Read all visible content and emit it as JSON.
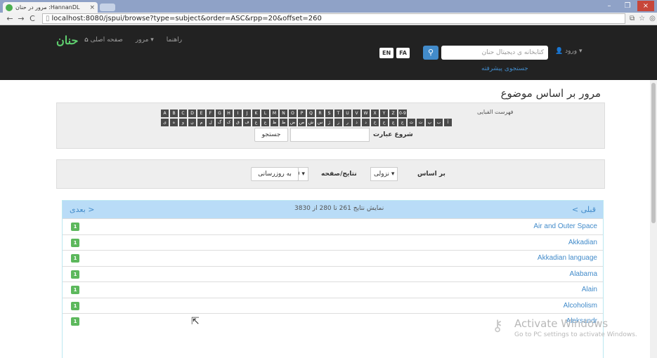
{
  "browser": {
    "tab_title": "مرور در حنان :HannanDL",
    "tab_close": "×",
    "url": "localhost:8080/jspui/browse?type=subject&order=ASC&rpp=20&offset=260",
    "back": "←",
    "forward": "→",
    "reload": "C",
    "win_min": "–",
    "win_max": "❐",
    "win_close": "×"
  },
  "navbar": {
    "logo": "حنان",
    "home": "صفحه اصلی",
    "browse": "مرور ▾",
    "help": "راهنما",
    "lang_en": "EN",
    "lang_fa": "FA",
    "search_placeholder": "کتابخانه ی دیجیتال حنان",
    "login": "ورود ▾",
    "advanced_search": "جستجوی پیشرفته"
  },
  "page_title": "مرور بر اساس موضوع",
  "jump": {
    "list_label": "فهرست الفبایی",
    "latin_letters": [
      "0-9",
      "Z",
      "Y",
      "X",
      "W",
      "V",
      "U",
      "T",
      "S",
      "R",
      "Q",
      "P",
      "O",
      "N",
      "M",
      "L",
      "K",
      "J",
      "I",
      "H",
      "G",
      "F",
      "E",
      "D",
      "C",
      "B",
      "A"
    ],
    "persian_letters": [
      "آ",
      "ب",
      "پ",
      "ت",
      "ث",
      "ج",
      "چ",
      "ح",
      "خ",
      "د",
      "ذ",
      "ر",
      "ز",
      "ژ",
      "س",
      "ش",
      "ص",
      "ض",
      "ط",
      "ظ",
      "ع",
      "غ",
      "ف",
      "ق",
      "ک",
      "گ",
      "ل",
      "م",
      "ن",
      "و",
      "ه",
      "ی"
    ],
    "starts_with_label": "شروع عبارت",
    "go_button": "جستجو"
  },
  "sort": {
    "by_label": "بر اساس",
    "order_value": "نزولی ▾",
    "results_per_page_label": "نتایج/صفحه",
    "rpp_value": "20 ▾",
    "update_button": "به روزرسانی"
  },
  "results": {
    "prev": "< قبلی",
    "next": "بعدی >",
    "count": "نمایش نتایج 261 تا 280 از 3830",
    "items": [
      {
        "count": "1",
        "subject": "Air and Outer Space"
      },
      {
        "count": "1",
        "subject": "Akkadian"
      },
      {
        "count": "1",
        "subject": "Akkadian language"
      },
      {
        "count": "1",
        "subject": "Alabama"
      },
      {
        "count": "1",
        "subject": "Alain"
      },
      {
        "count": "1",
        "subject": "Alcoholism"
      },
      {
        "count": "1",
        "subject": "Aleksandr"
      }
    ]
  },
  "watermark": {
    "line1": "Activate Windows",
    "line2": "Go to PC settings to activate Windows."
  }
}
